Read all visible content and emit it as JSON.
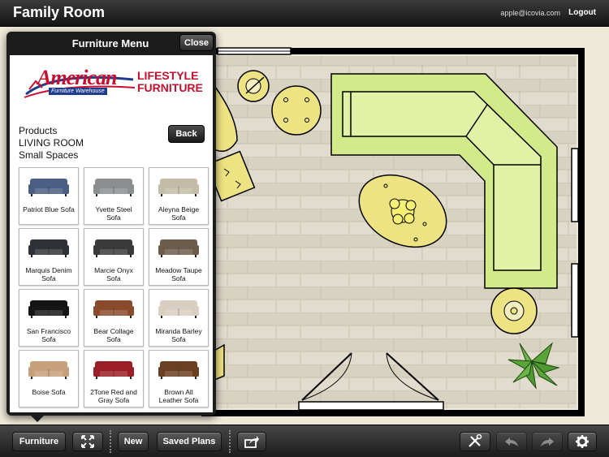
{
  "header": {
    "title": "Family Room",
    "email": "apple@icovia.com",
    "logout_label": "Logout"
  },
  "menu": {
    "title": "Furniture Menu",
    "close_label": "Close",
    "brand": {
      "name": "American",
      "sub": "Furniture Warehouse",
      "line1": "LIFESTYLE",
      "line2": "FURNITURE"
    },
    "breadcrumb": [
      "Products",
      "LIVING ROOM",
      "Small Spaces"
    ],
    "back_label": "Back",
    "products": [
      {
        "line1": "Patriot Blue Sofa",
        "line2": "",
        "color": "#4b5f84"
      },
      {
        "line1": "Yvette Steel",
        "line2": "Sofa",
        "color": "#8c8e92"
      },
      {
        "line1": "Aleyna Beige",
        "line2": "Sofa",
        "color": "#c4bca6"
      },
      {
        "line1": "Marquis Denim",
        "line2": "Sofa",
        "color": "#2f3136"
      },
      {
        "line1": "Marcie Onyx",
        "line2": "Sofa",
        "color": "#3a3a3a"
      },
      {
        "line1": "Meadow Taupe",
        "line2": "Sofa",
        "color": "#6c5c4c"
      },
      {
        "line1": "San Francisco",
        "line2": "Sofa",
        "color": "#151515"
      },
      {
        "line1": "Bear Collage",
        "line2": "Sofa",
        "color": "#8a4b2c"
      },
      {
        "line1": "Miranda Barley",
        "line2": "Sofa",
        "color": "#d8cfc1"
      },
      {
        "line1": "Boise Sofa",
        "line2": "",
        "color": "#c5a07a"
      },
      {
        "line1": "2Tone Red and",
        "line2": "Gray Sofa",
        "color": "#9b1e26"
      },
      {
        "line1": "Brown All",
        "line2": "Leather Sofa",
        "color": "#6a3f22"
      }
    ]
  },
  "toolbar": {
    "furniture_label": "Furniture",
    "new_label": "New",
    "saved_plans_label": "Saved Plans",
    "icons": [
      "fullscreen-icon",
      "share-icon",
      "tools-icon",
      "undo-icon",
      "redo-icon",
      "gear-icon"
    ]
  },
  "colors": {
    "floor": "#dcd6c6",
    "wall": "#000000",
    "sofa": "#d3ea8b",
    "accent_yellow": "#ede382",
    "plant": "#5aa43a"
  }
}
